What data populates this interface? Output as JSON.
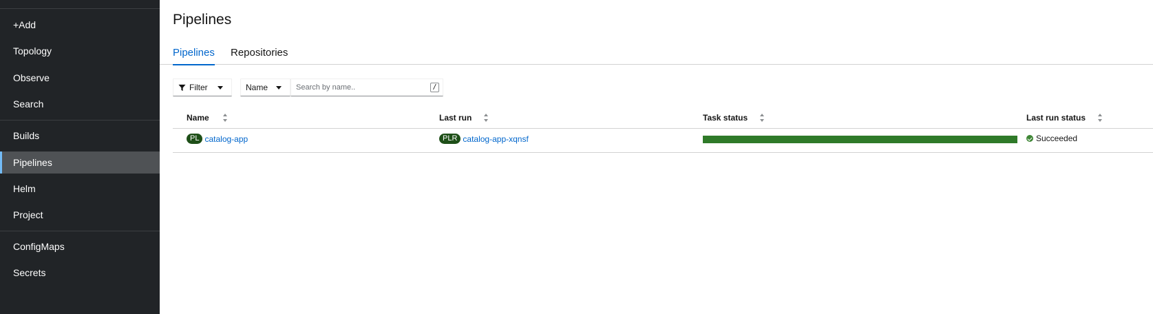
{
  "sidebar": {
    "items": [
      {
        "label": "+Add"
      },
      {
        "label": "Topology"
      },
      {
        "label": "Observe"
      },
      {
        "label": "Search"
      },
      {
        "label": "Builds"
      },
      {
        "label": "Pipelines",
        "active": true
      },
      {
        "label": "Helm"
      },
      {
        "label": "Project"
      },
      {
        "label": "ConfigMaps"
      },
      {
        "label": "Secrets"
      }
    ]
  },
  "page": {
    "title": "Pipelines",
    "tabs": [
      {
        "label": "Pipelines",
        "active": true
      },
      {
        "label": "Repositories"
      }
    ]
  },
  "toolbar": {
    "filter_label": "Filter",
    "name_select": "Name",
    "search_placeholder": "Search by name..",
    "search_value": "",
    "shortcut_hint": "/"
  },
  "table": {
    "columns": [
      "Name",
      "Last run",
      "Task status",
      "Last run status"
    ],
    "rows": [
      {
        "name_badge": "PL",
        "name": "catalog-app",
        "last_run_badge": "PLR",
        "last_run": "catalog-app-xqnsf",
        "task_status_progress": 1.0,
        "last_run_status": "Succeeded"
      }
    ]
  },
  "colors": {
    "sidebar_bg": "#212427",
    "accent": "#0066cc",
    "success": "#3e8635",
    "badge_bg": "#1e4f18"
  }
}
